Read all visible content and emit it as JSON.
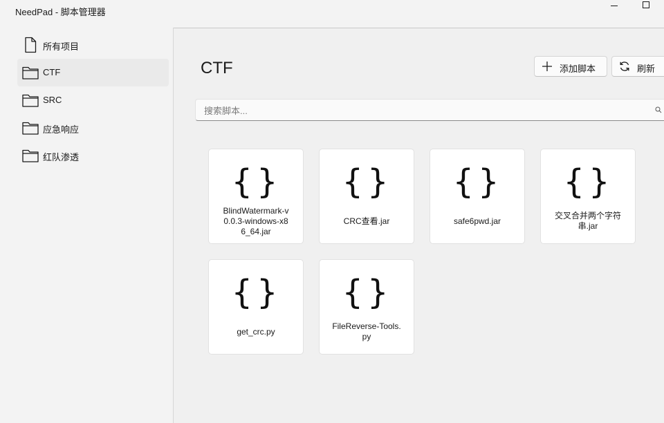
{
  "window": {
    "title": "NeedPad - 脚本管理器"
  },
  "sidebar": {
    "items": [
      {
        "label": "所有项目",
        "icon": "file-icon",
        "active": false
      },
      {
        "label": "CTF",
        "icon": "folder-icon",
        "active": true
      },
      {
        "label": "SRC",
        "icon": "folder-icon",
        "active": false
      },
      {
        "label": "应急响应",
        "icon": "folder-icon",
        "active": false
      },
      {
        "label": "红队渗透",
        "icon": "folder-icon",
        "active": false
      }
    ]
  },
  "main": {
    "title": "CTF",
    "add_label": "添加脚本",
    "refresh_label": "刷新",
    "search": {
      "placeholder": "搜索脚本...",
      "value": ""
    },
    "cards": [
      {
        "name": "BlindWatermark-v0.0.3-windows-x86_64.jar",
        "icon": "braces-icon"
      },
      {
        "name": "CRC查看.jar",
        "icon": "braces-icon"
      },
      {
        "name": "safe6pwd.jar",
        "icon": "braces-icon"
      },
      {
        "name": "交叉合并两个字符串.jar",
        "icon": "braces-icon"
      },
      {
        "name": "get_crc.py",
        "icon": "braces-icon"
      },
      {
        "name": "FileReverse-Tools.py",
        "icon": "braces-icon"
      }
    ],
    "braces_glyph": "{}"
  }
}
